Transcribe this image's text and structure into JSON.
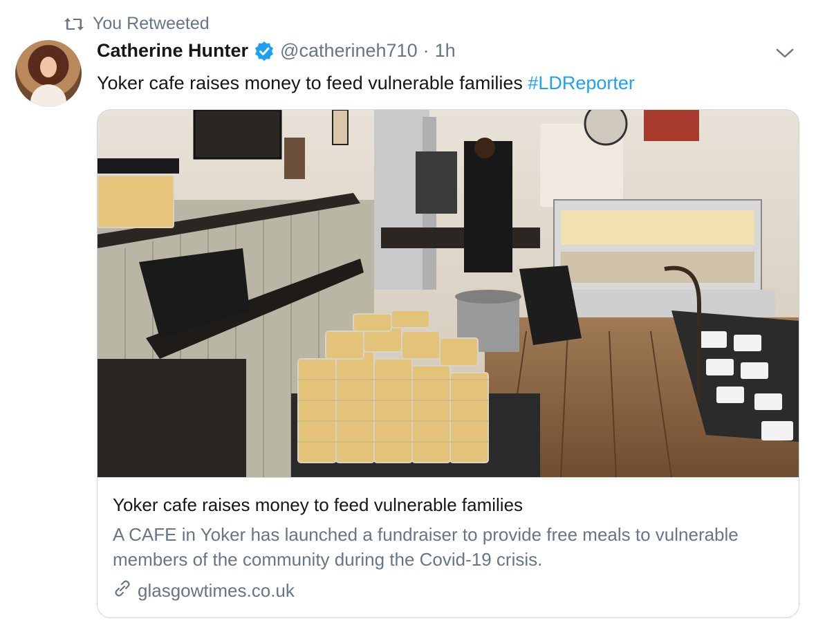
{
  "retweet": {
    "label": "You Retweeted"
  },
  "author": {
    "name": "Catherine Hunter",
    "handle": "@catherineh710",
    "separator": "·",
    "time": "1h",
    "verified": true
  },
  "tweet": {
    "text": "Yoker cafe raises money to feed vulnerable families ",
    "hashtag": "#LDReporter"
  },
  "card": {
    "image_alt": "Photo of a cafe interior with stacks of food containers",
    "title": "Yoker cafe raises money to feed vulnerable families",
    "description": "A CAFE in Yoker has launched a fundraiser to provide free meals to vulnerable members of the community during the Covid-19 crisis.",
    "domain": "glasgowtimes.co.uk",
    "link_icon": "link-icon"
  },
  "icons": {
    "retweet": "retweet-icon",
    "verified": "verified-icon",
    "caret": "chevron-down-icon"
  },
  "colors": {
    "accent": "#1da1f2",
    "text": "#14171a",
    "secondary": "#657786",
    "border": "#ccd6dd"
  }
}
